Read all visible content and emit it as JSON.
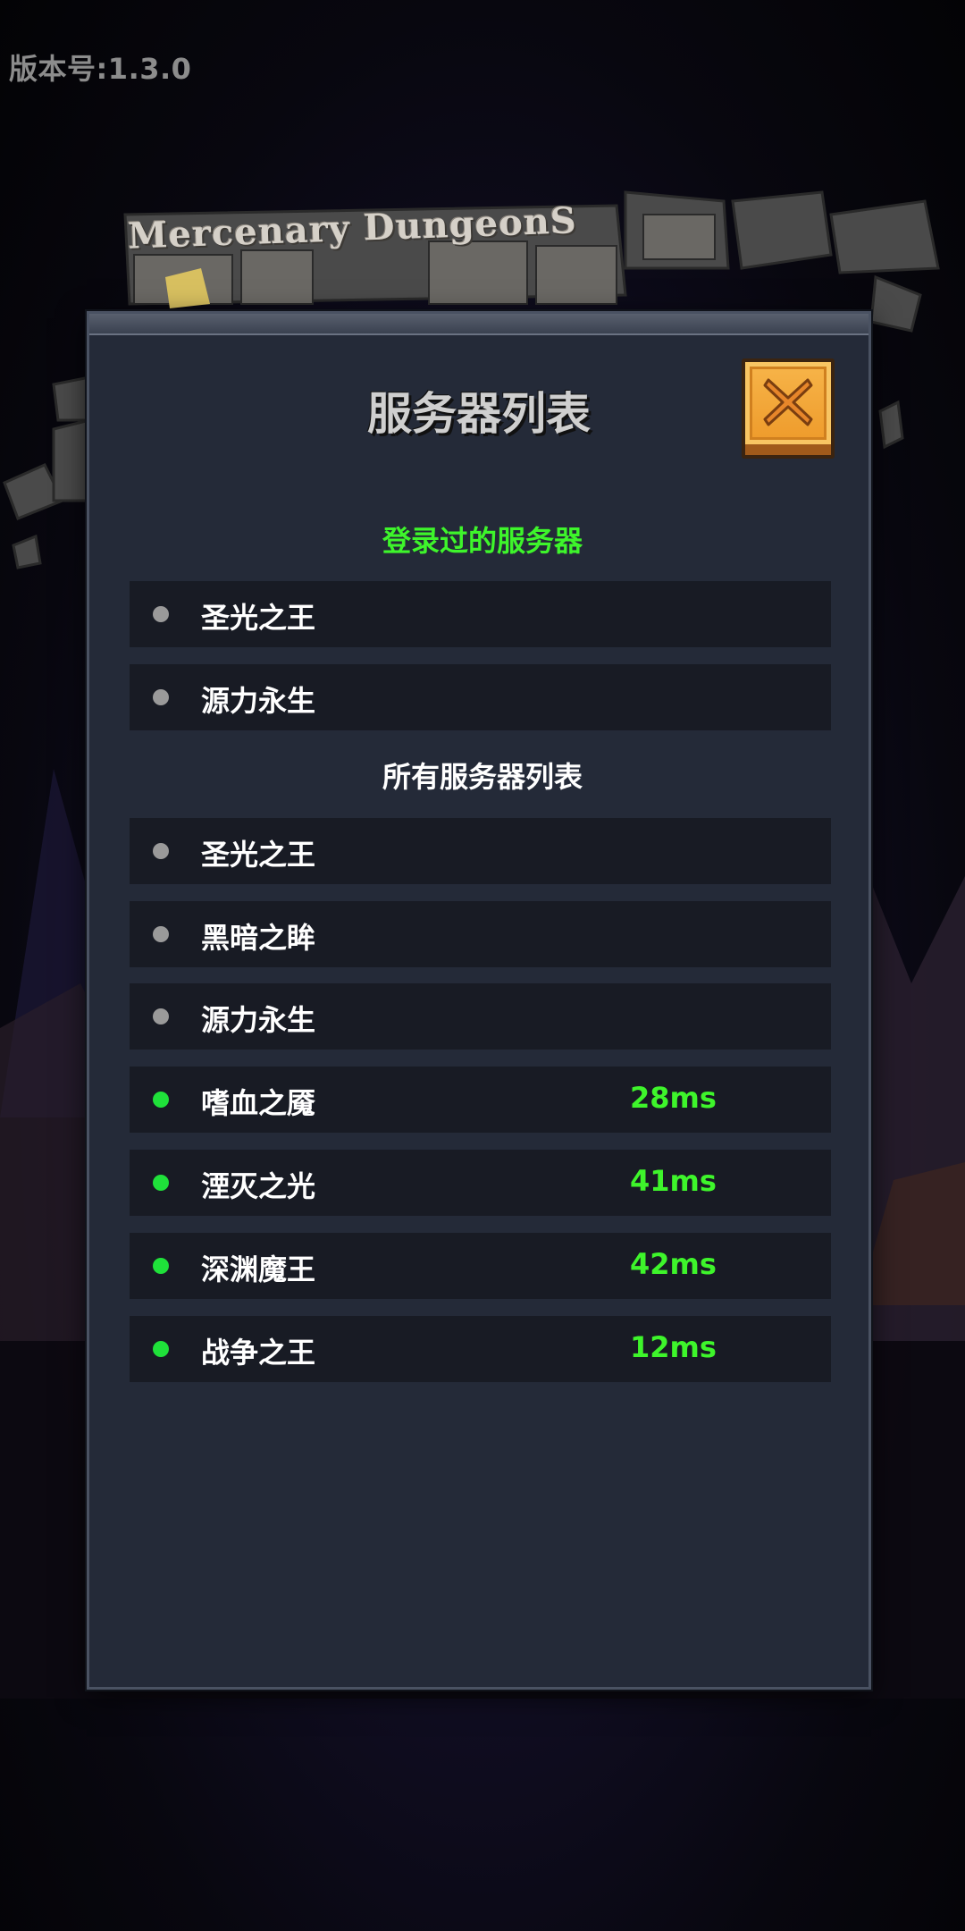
{
  "version_label": "版本号:1.3.0",
  "logo": {
    "title": "Mercenary DungeonS"
  },
  "panel": {
    "title": "服务器列表",
    "close_icon": "close-icon"
  },
  "recent": {
    "heading": "登录过的服务器",
    "servers": [
      {
        "name": "圣光之王",
        "status": "offline"
      },
      {
        "name": "源力永生",
        "status": "offline"
      }
    ]
  },
  "all": {
    "heading": "所有服务器列表",
    "servers": [
      {
        "name": "圣光之王",
        "status": "offline",
        "ping": ""
      },
      {
        "name": "黑暗之眸",
        "status": "offline",
        "ping": ""
      },
      {
        "name": "源力永生",
        "status": "offline",
        "ping": ""
      },
      {
        "name": "嗜血之魇",
        "status": "online",
        "ping": "28ms"
      },
      {
        "name": "湮灭之光",
        "status": "online",
        "ping": "41ms"
      },
      {
        "name": "深渊魔王",
        "status": "online",
        "ping": "42ms"
      },
      {
        "name": "战争之王",
        "status": "online",
        "ping": "12ms"
      }
    ]
  },
  "colors": {
    "online": "#1fe13a",
    "offline": "#9a9a9a",
    "accent_green": "#3ef52b",
    "panel_bg": "#242a38",
    "row_bg": "#181b24",
    "close_button": "#f0a030"
  }
}
